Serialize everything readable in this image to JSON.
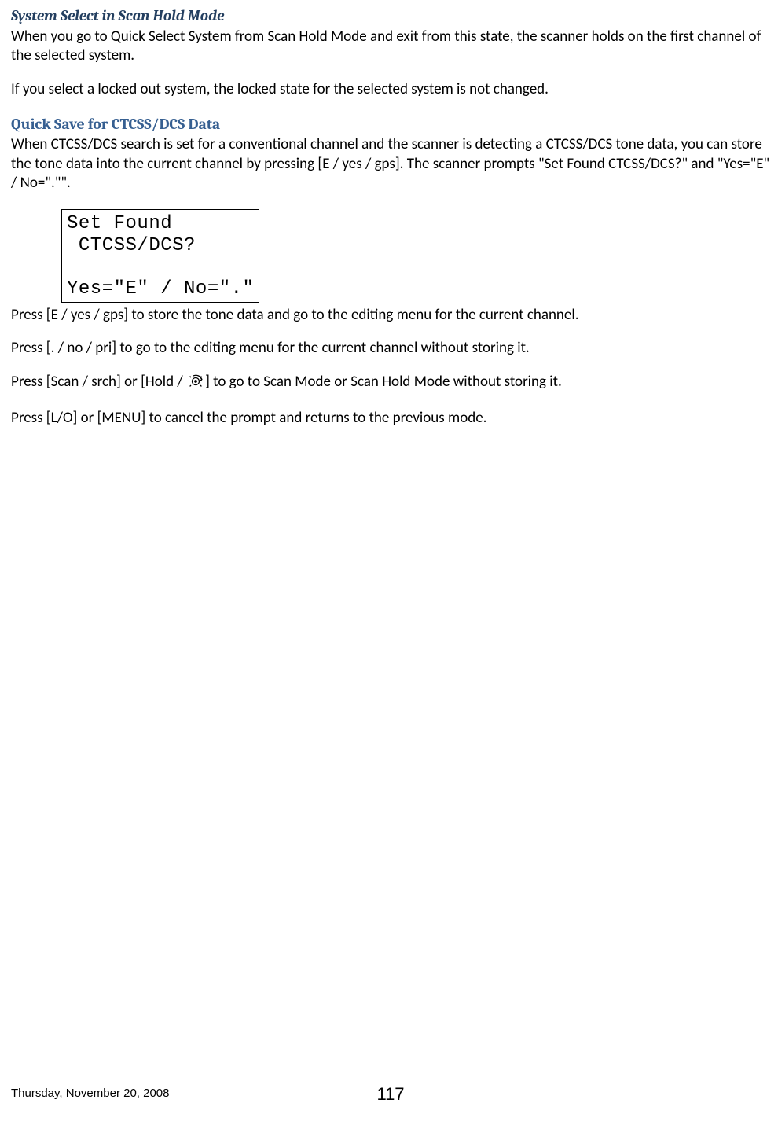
{
  "section1": {
    "heading": "System Select in Scan Hold Mode",
    "para1": "When you go to Quick Select System from Scan Hold Mode and exit from this state, the scanner holds on the first channel of the selected system.",
    "para2": "If you select a locked out system, the locked state for the selected system is not changed."
  },
  "section2": {
    "heading": "Quick Save for CTCSS/DCS  Data",
    "para1": "When CTCSS/DCS search is set for a conventional channel and the scanner is detecting a CTCSS/DCS tone data, you can store the tone data into the current channel by pressing [E / yes / gps]. The scanner prompts \"Set Found CTCSS/DCS?\" and \"Yes=\"E\" / No=\".\"\"."
  },
  "lcd": {
    "line1": "Set Found",
    "line2": " CTCSS/DCS?",
    "line3": " ",
    "line4": "Yes=\"E\" / No=\".\""
  },
  "after": {
    "para1": "Press [E / yes / gps] to store the tone data and go to the editing menu for the current channel.",
    "para2": "Press [. / no / pri] to go to the editing menu for the current channel without storing it.",
    "para3a": "Press [Scan / srch] or [Hold / ",
    "para3b": "] to go to Scan Mode or Scan Hold Mode without storing it.",
    "para4": "Press [L/O] or [MENU] to cancel the prompt and returns to the previous mode."
  },
  "footer": {
    "date": "Thursday, November 20, 2008",
    "page": "117"
  }
}
